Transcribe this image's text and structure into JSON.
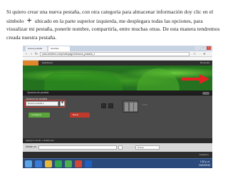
{
  "instructions": {
    "part1": "Si quiero crear una nueva pestaña, con otra categoría para almacenar información doy clic en el símbolo",
    "symbol": "+",
    "part2": "ubicado en la parte superior izquierda,  me desplegara todas las opciones, para visualizar mi pestaña, ponerle nombre, compartirla, entre muchas otras. De esta manera tendremos creada nuestra pestaña."
  },
  "browser": {
    "tabs": [
      "Nueva pestaña",
      "Netvibes"
    ],
    "url": "www.netvibes.com/privatepage/1#Nueva_pestaña_1",
    "window_buttons": [
      "–",
      "□",
      "x"
    ]
  },
  "site": {
    "menu": "Dashboard",
    "user": "Mi cuenta"
  },
  "editor": {
    "label": "Opciones de pestaña",
    "panel_title": "Opciones de pestaña",
    "tab_name": "Nueva pestaña 1",
    "plus": "+",
    "config_button": "Configurar",
    "delete_button": "Borrar",
    "dots": "• • •"
  },
  "subbar": {
    "label": "Agrega tu feeds, o añade app"
  },
  "url_row": {
    "label": "Añadir url",
    "select": "Nueva"
  },
  "footer": {
    "publish": "Guardar ▸"
  },
  "taskbar": {
    "time": "1:05 p. m.",
    "date": "24/03/2015"
  },
  "colors": {
    "highlight": "#d43a2f",
    "arrow": "#e52222",
    "taskbar": "#2b4a7c"
  }
}
